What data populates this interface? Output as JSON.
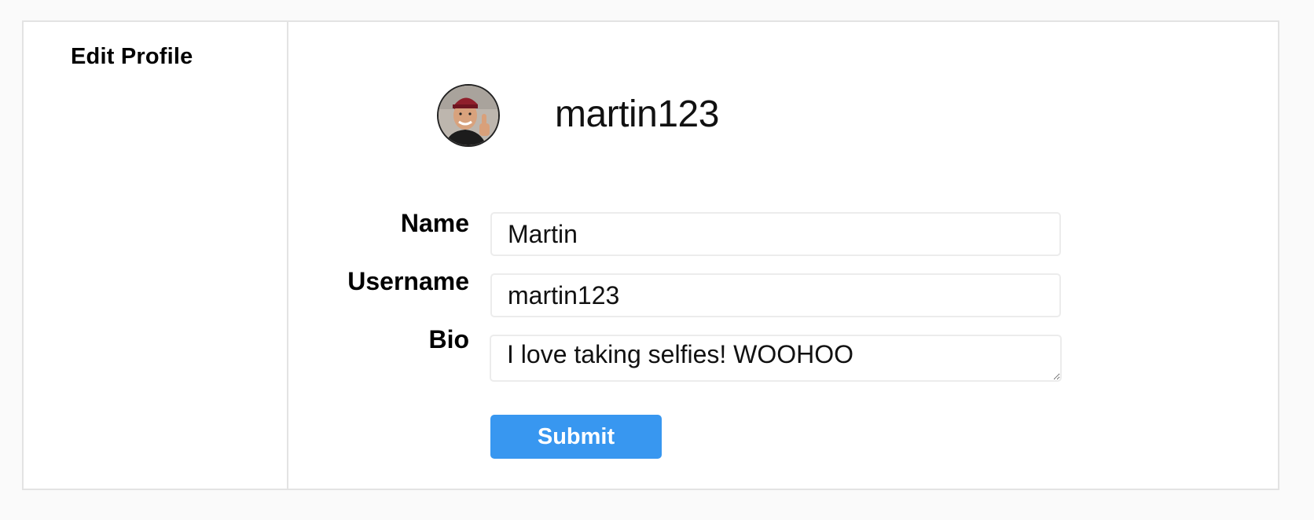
{
  "sidebar": {
    "items": [
      {
        "label": "Edit Profile"
      }
    ]
  },
  "profile": {
    "username": "martin123",
    "avatar": "user-avatar-photo"
  },
  "form": {
    "name": {
      "label": "Name",
      "value": "Martin"
    },
    "username": {
      "label": "Username",
      "value": "martin123"
    },
    "bio": {
      "label": "Bio",
      "value": "I love taking selfies! WOOHOO"
    },
    "submit_label": "Submit"
  },
  "colors": {
    "accent": "#3897f0",
    "background": "#fafafa",
    "border": "#e3e3e3"
  }
}
